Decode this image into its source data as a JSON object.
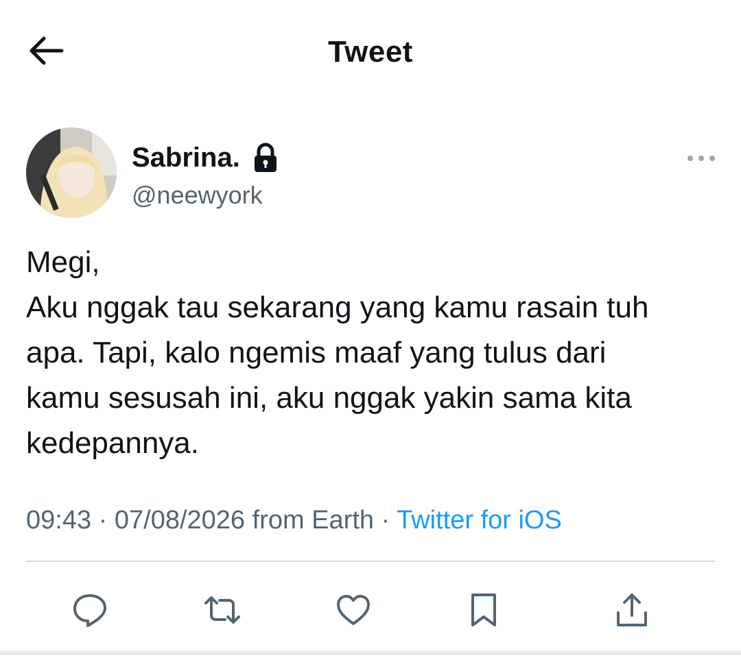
{
  "header": {
    "title": "Tweet",
    "back_icon": "arrow-left-icon"
  },
  "author": {
    "display_name": "Sabrina.",
    "handle": "@neewyork",
    "protected_icon": "lock-icon",
    "avatar_icon": "avatar"
  },
  "tweet": {
    "lines": [
      "Megi,",
      "Aku nggak tau sekarang yang kamu rasain tuh",
      "apa. Tapi, kalo ngemis maaf yang tulus dari",
      "kamu sesusah ini, aku nggak yakin sama kita",
      "kedepannya."
    ],
    "time": "09:43",
    "separator": "·",
    "date": "07/08/2026",
    "location": "from Earth",
    "source": "Twitter for iOS"
  },
  "actions": {
    "reply_icon": "reply-icon",
    "retweet_icon": "retweet-icon",
    "like_icon": "heart-icon",
    "bookmark_icon": "bookmark-icon",
    "share_icon": "share-icon"
  },
  "colors": {
    "text": "#0f1419",
    "secondary": "#536471",
    "accent": "#1d9bf0",
    "divider": "#cfd9de"
  }
}
